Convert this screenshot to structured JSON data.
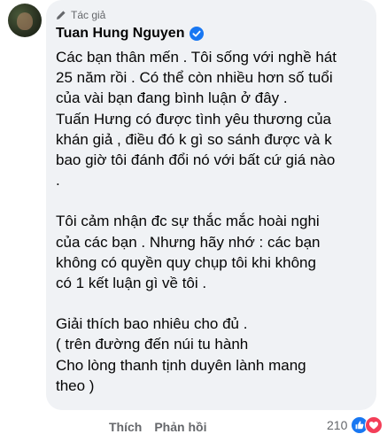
{
  "comment": {
    "author_badge_label": "Tác giả",
    "author_name": "Tuan Hung Nguyen",
    "paragraphs": [
      [
        "Các bạn thân mến . Tôi sống với nghề hát",
        "25 năm rồi . Có thể còn nhiều hơn số tuổi",
        "của vài bạn đang bình luận ở đây .",
        "Tuấn Hưng có được tình yêu thương của",
        "khán giả , điều đó k gì so sánh được và k",
        "bao giờ tôi đánh đổi nó với bất cứ giá nào",
        "."
      ],
      [
        "Tôi cảm nhận đc sự thắc mắc hoài nghi",
        "của các bạn . Nhưng hãy nhớ :  các bạn",
        "không có quyền quy chụp tôi khi không",
        "có 1 kết luận gì về tôi ."
      ],
      [
        "Giải thích bao nhiêu cho đủ .",
        " ( trên đường đến núi tu hành",
        "Cho lòng thanh tịnh duyên lành mang",
        "theo )"
      ]
    ]
  },
  "actions": {
    "like_label": "Thích",
    "reply_label": "Phản hồi"
  },
  "reactions": {
    "count": "210",
    "icons": [
      "like-icon",
      "love-icon"
    ],
    "colors": {
      "like": "#1877f2",
      "love": "#f33e58",
      "verified": "#1877f2"
    }
  }
}
